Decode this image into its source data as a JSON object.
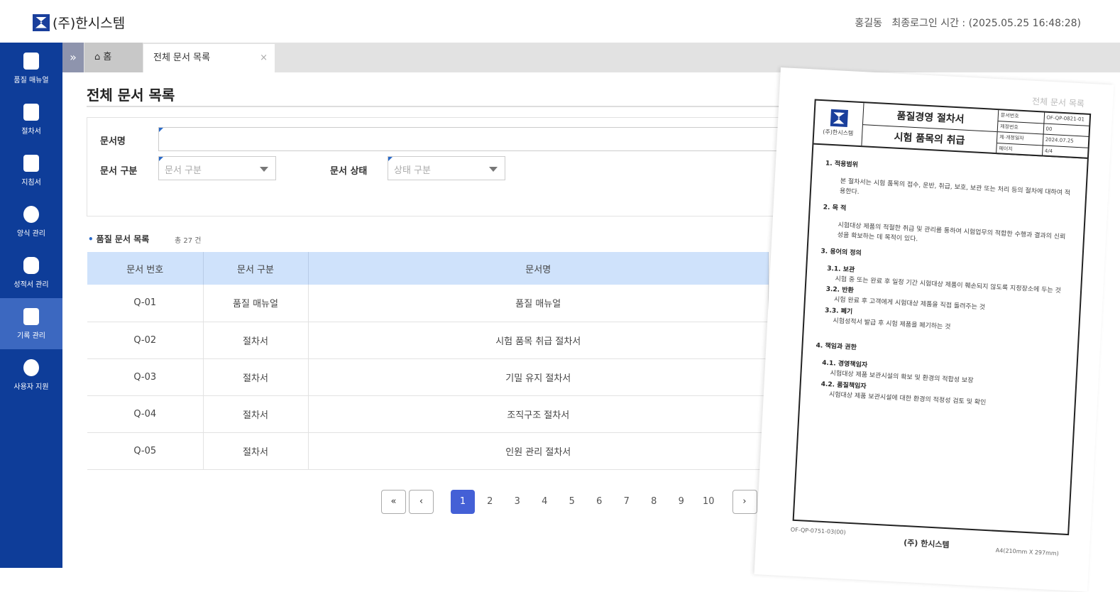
{
  "header": {
    "company": "(주)한시스템",
    "user": "홍길동",
    "last_login": "최종로그인 시간 : (2025.05.25 16:48:28)"
  },
  "sidebar": {
    "items": [
      {
        "label": "품질 매뉴얼"
      },
      {
        "label": "절차서"
      },
      {
        "label": "지침서"
      },
      {
        "label": "양식 관리"
      },
      {
        "label": "성적서 관리"
      },
      {
        "label": "기록 관리"
      },
      {
        "label": "사용자 지원"
      }
    ]
  },
  "tabs": {
    "expand": "»",
    "home": "홈",
    "current": "전체 문서 목록",
    "close": "×"
  },
  "page": {
    "title": "전체 문서 목록"
  },
  "search": {
    "name_label": "문서명",
    "name_value": "",
    "type_label": "문서 구분",
    "type_placeholder": "문서 구분",
    "status_label": "문서 상태",
    "status_placeholder": "상태 구분"
  },
  "list": {
    "title": "품질 문서 목록",
    "count": "총 27 건",
    "columns": [
      "문서 번호",
      "문서 구분",
      "문서명"
    ],
    "rows": [
      [
        "Q-01",
        "품질 매뉴얼",
        "품질 매뉴얼"
      ],
      [
        "Q-02",
        "절차서",
        "시험 품목 취급 절차서"
      ],
      [
        "Q-03",
        "절차서",
        "기밀 유지 절차서"
      ],
      [
        "Q-04",
        "절차서",
        "조직구조 절차서"
      ],
      [
        "Q-05",
        "절차서",
        "인원 관리 절차서"
      ]
    ]
  },
  "pagination": {
    "first": "«",
    "prev": "‹",
    "pages": [
      "1",
      "2",
      "3",
      "4",
      "5",
      "6",
      "7",
      "8",
      "9",
      "10"
    ],
    "current": "1",
    "next": "›"
  },
  "document": {
    "ghost_title": "전체 문서 목록",
    "company": "(주)한시스템",
    "title": "품질경영 절차서",
    "subtitle": "시험 품목의 취급",
    "meta": [
      [
        "문서번호",
        "OF-QP-0821-01"
      ],
      [
        "제정번호",
        "00"
      ],
      [
        "제·개정일자",
        "2024.07.25"
      ],
      [
        "페이지",
        "4/4"
      ]
    ],
    "sections": [
      {
        "heading": "1. 적용범위",
        "text": "본 절차서는 시험 품목의 접수, 운반, 취급, 보호, 보관 또는 처리 등의 절차에 대하여 적용한다."
      },
      {
        "heading": "2. 목 적",
        "text": "시험대상 제품의 적절한 취급 및 관리를 통하여 시험업무의 적합한 수행과 결과의 신뢰성을 확보하는 데 목적이 있다."
      },
      {
        "heading": "3. 용어의 정의",
        "text": ""
      }
    ],
    "subsections": [
      {
        "heading": "3.1. 보관",
        "text": "시험 중 또는 완료 후 일정 기간 시험대상 제품이 훼손되지 않도록 지정장소에 두는 것"
      },
      {
        "heading": "3.2. 반환",
        "text": "시험 완료 후 고객에게 시험대상 제품을 직접 돌려주는 것"
      },
      {
        "heading": "3.3. 폐기",
        "text": "시험성적서 발급 후 시험 제품을 폐기하는 것"
      }
    ],
    "section4": "4. 책임과 권한",
    "subsections4": [
      {
        "heading": "4.1. 경영책임자",
        "text": "시험대상 제품 보관시설의 확보 및 환경의 적합성 보장"
      },
      {
        "heading": "4.2. 품질책임자",
        "text": "시험대상 제품 보관시설에 대한 환경의 적정성 검토 및 확인"
      }
    ],
    "footer_code": "OF-QP-0751-03(00)",
    "footer_company": "(주) 한시스템",
    "footer_size": "A4(210mm X 297mm)"
  }
}
